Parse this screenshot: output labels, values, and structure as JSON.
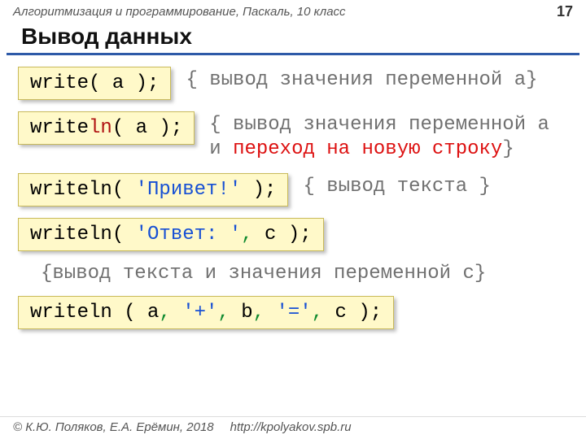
{
  "header": {
    "breadcrumb": "Алгоритмизация и программирование, Паскаль, 10 класс",
    "pagenum": "17"
  },
  "title": "Вывод данных",
  "rows": [
    {
      "code": {
        "p1": "write( a );"
      },
      "comment": {
        "t1": "{ вывод значения переменной a}"
      }
    },
    {
      "code": {
        "p1": "write",
        "p2_red": "ln",
        "p3": "( a );"
      },
      "comment": {
        "t1": "{ вывод значения переменной a и ",
        "t2_red": "переход на новую строку",
        "t3": "}"
      }
    },
    {
      "code": {
        "p1": "writeln( ",
        "p2_blue": "'Привет!'",
        "p3": " );"
      },
      "comment": {
        "t1": "{ вывод текста }"
      }
    },
    {
      "code": {
        "p1": "writeln( ",
        "p2_blue": "'Ответ: '",
        "p3_green": ",",
        "p4": " c );"
      }
    }
  ],
  "midcomment": "{вывод текста и значения переменной c}",
  "lastcode": {
    "p1": "writeln ( a",
    "c1": ",",
    "s1": " ",
    "p2": "'+'",
    "c2": ",",
    "s2": " ",
    "p3": "b",
    "c3": ",",
    "s3": " ",
    "p4": "'='",
    "c4": ",",
    "s4": " ",
    "p5": "c );"
  },
  "footer": {
    "copyright": "© К.Ю. Поляков, Е.А. Ерёмин, 2018",
    "url": "http://kpolyakov.spb.ru"
  }
}
